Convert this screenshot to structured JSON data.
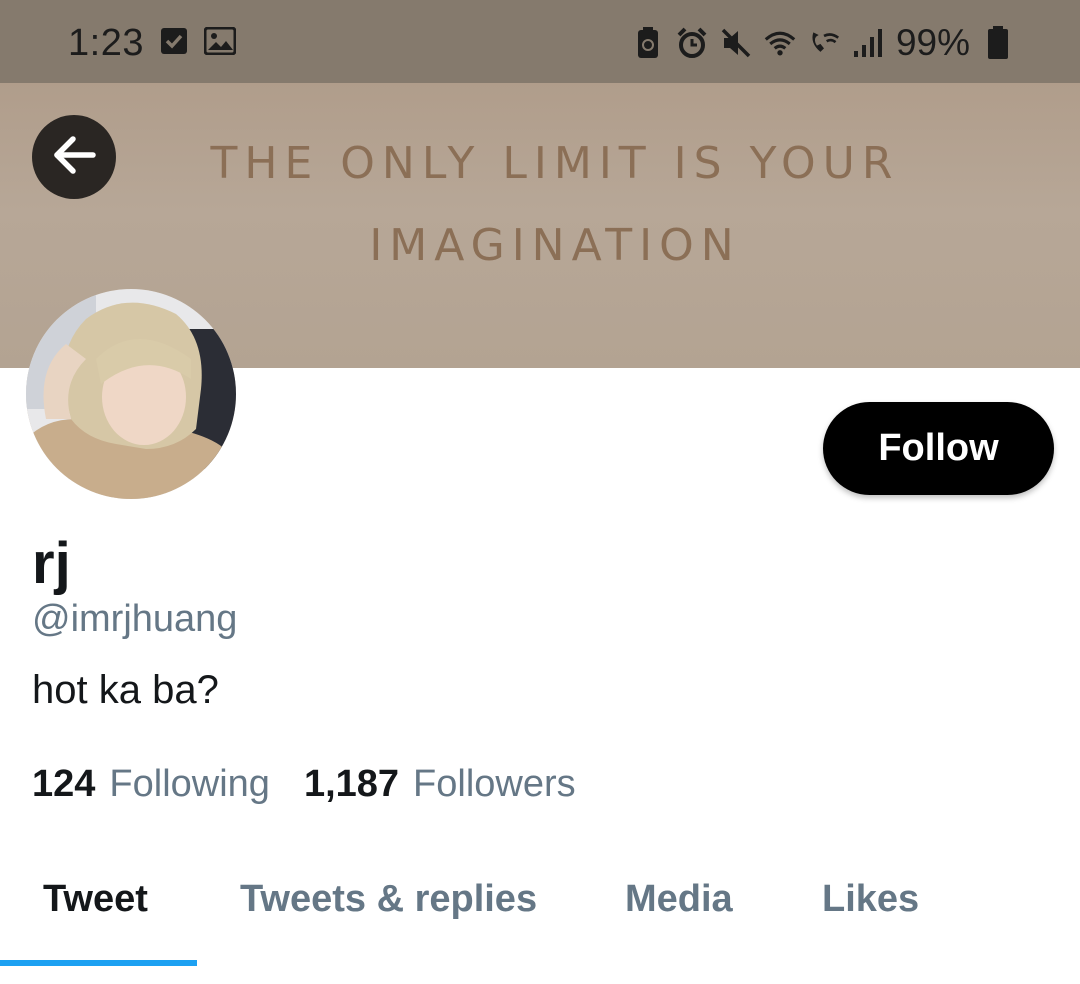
{
  "status_bar": {
    "time": "1:23",
    "battery_percent": "99%",
    "left_icons": [
      "checkbox-notification-icon",
      "image-notification-icon"
    ],
    "right_icons": [
      "battery-saver-icon",
      "alarm-icon",
      "mute-icon",
      "wifi-icon",
      "wifi-calling-icon",
      "signal-icon",
      "battery-icon"
    ]
  },
  "banner": {
    "line1": "THE ONLY LIMIT IS YOUR",
    "line2": "IMAGINATION",
    "text_color": "#8b6f56"
  },
  "profile": {
    "display_name": "rj",
    "handle": "@imrjhuang",
    "bio": "hot ka ba?",
    "follow_label": "Follow",
    "following_count": "124",
    "following_label": "Following",
    "followers_count": "1,187",
    "followers_label": "Followers"
  },
  "tabs": [
    {
      "label": "Tweet",
      "active": true
    },
    {
      "label": "Tweets & replies",
      "active": false
    },
    {
      "label": "Media",
      "active": false
    },
    {
      "label": "Likes",
      "active": false
    }
  ],
  "colors": {
    "accent": "#1da1f2",
    "secondary_text": "#657786",
    "primary_text": "#14171a",
    "status_bar": "#857a6d"
  }
}
